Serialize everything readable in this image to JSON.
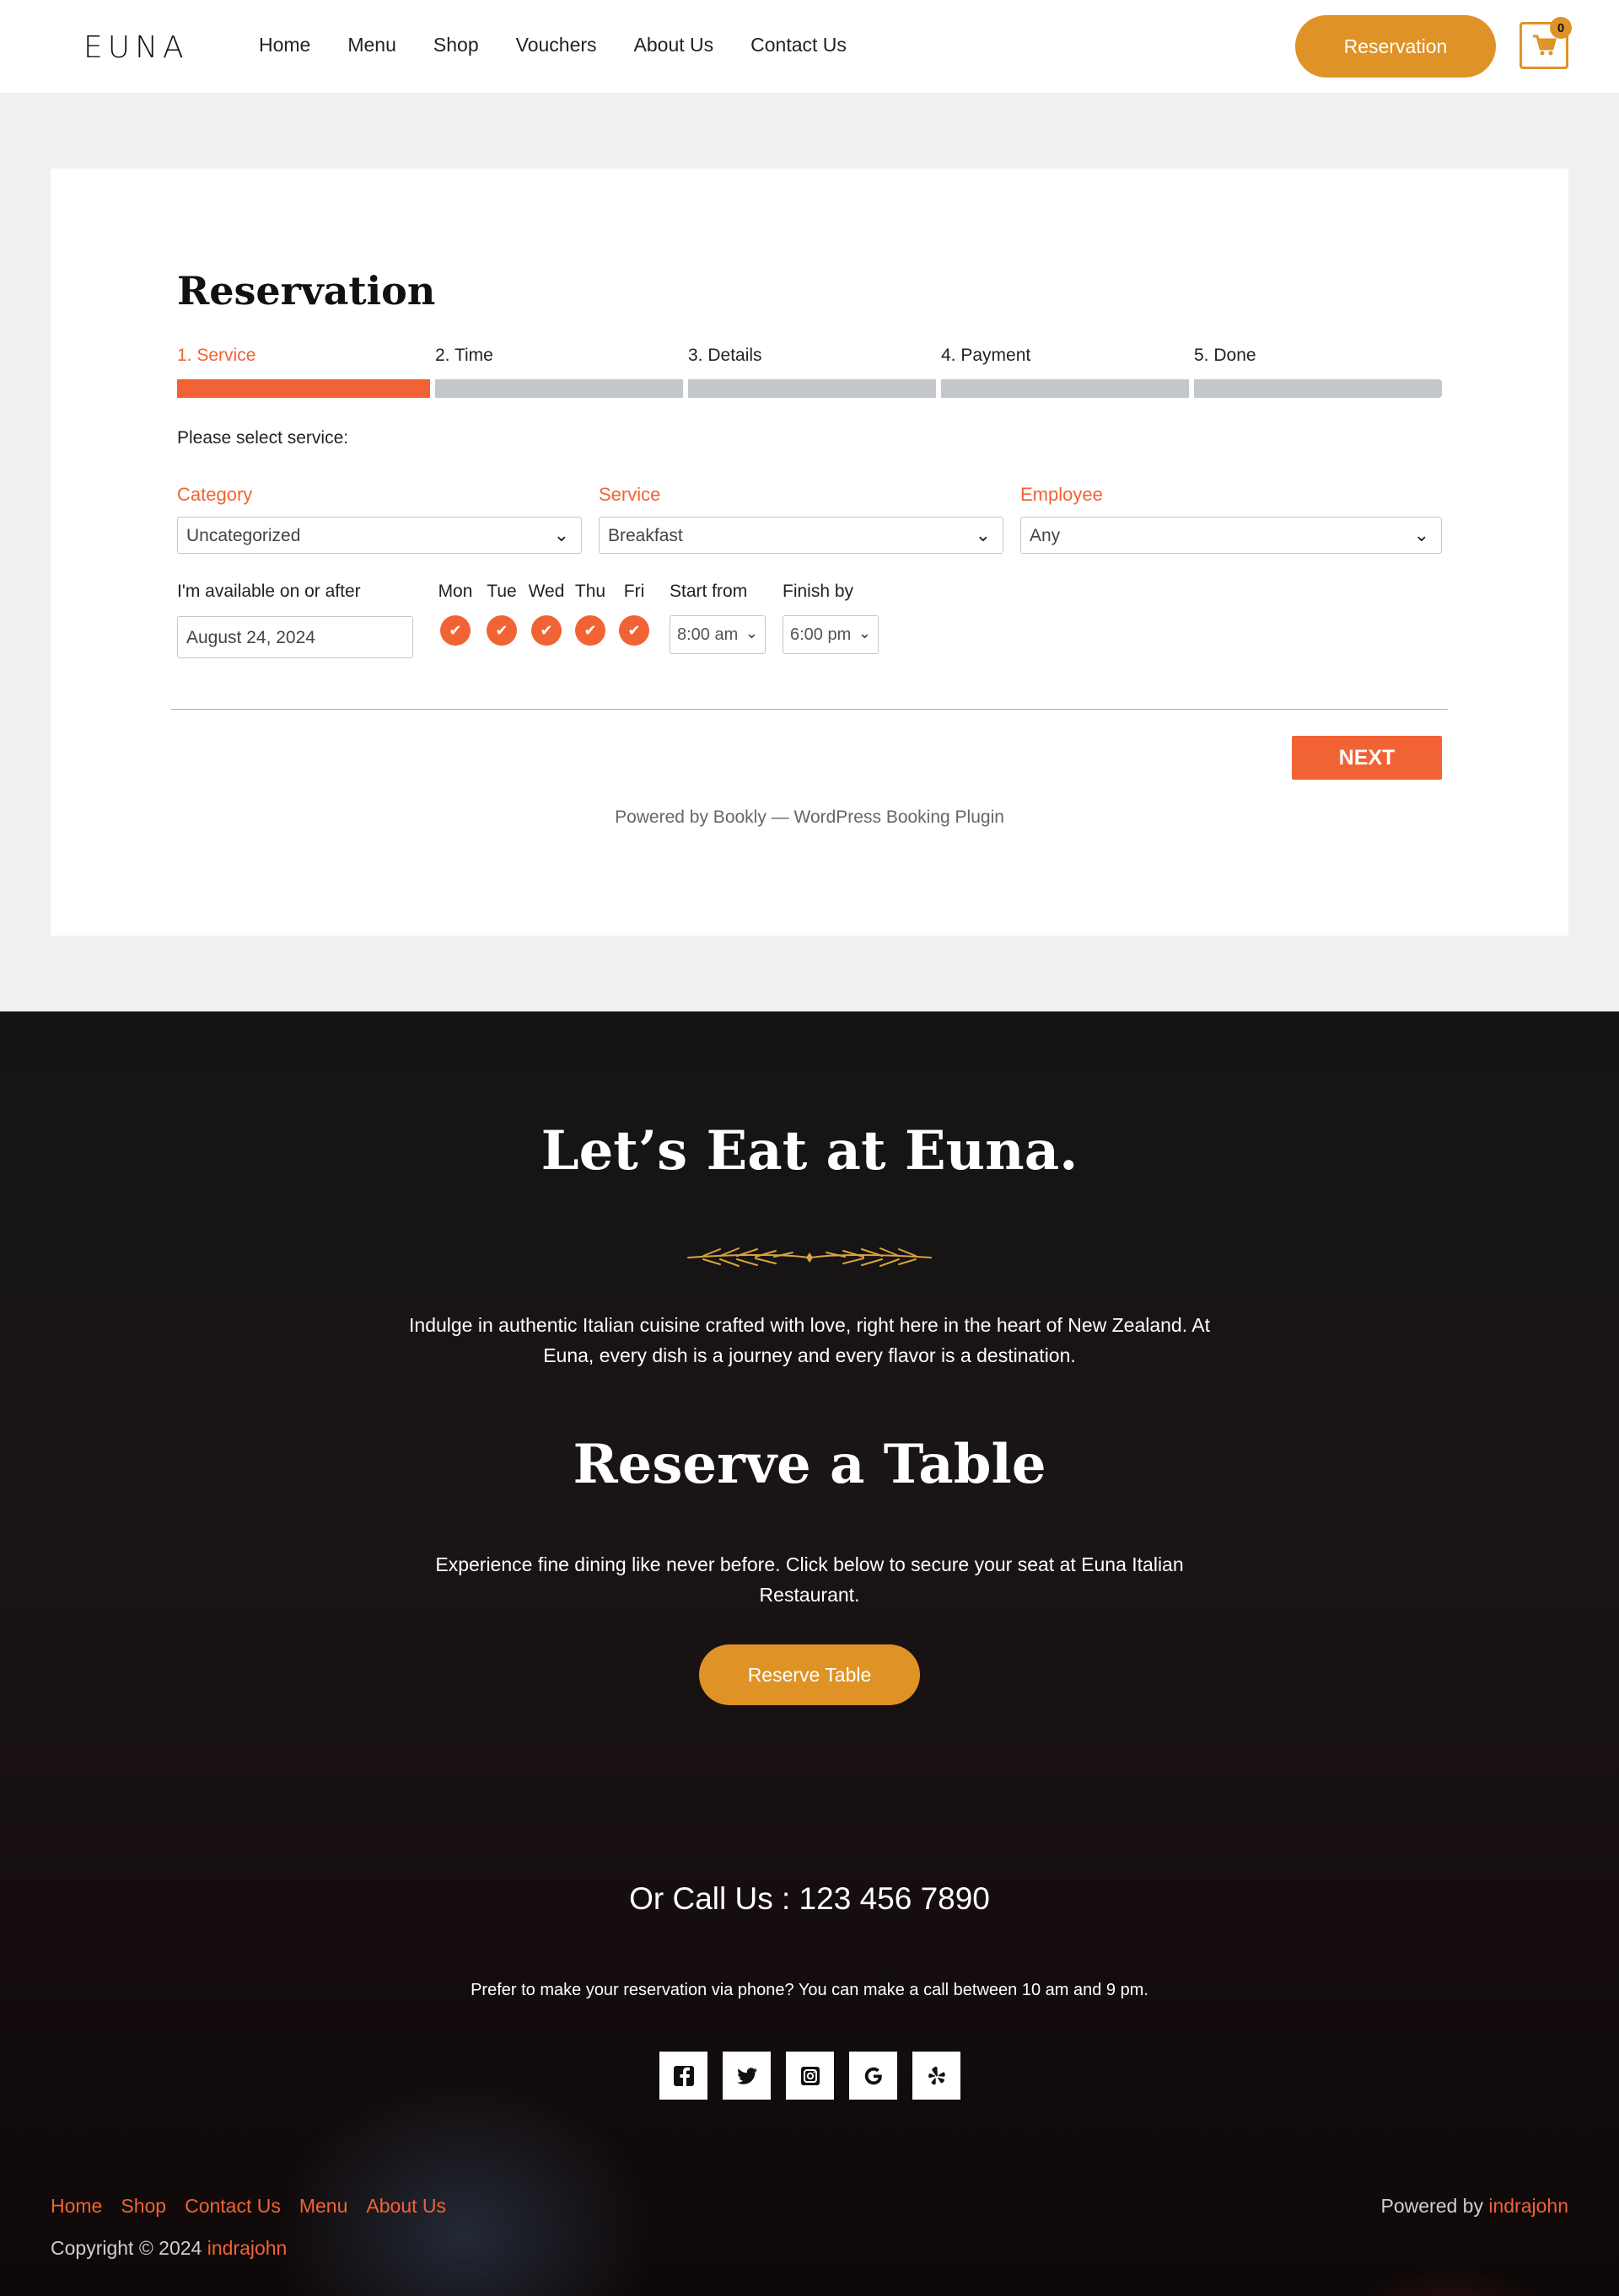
{
  "header": {
    "logo": "EUNA",
    "nav": [
      "Home",
      "Menu",
      "Shop",
      "Vouchers",
      "About Us",
      "Contact Us"
    ],
    "reservation_button": "Reservation",
    "cart_count": "0"
  },
  "booking": {
    "title": "Reservation",
    "steps": [
      {
        "label": "1. Service",
        "active": true
      },
      {
        "label": "2. Time",
        "active": false
      },
      {
        "label": "3. Details",
        "active": false
      },
      {
        "label": "4. Payment",
        "active": false
      },
      {
        "label": "5. Done",
        "active": false
      }
    ],
    "prompt": "Please select service:",
    "category_label": "Category",
    "category_value": "Uncategorized",
    "service_label": "Service",
    "service_value": "Breakfast",
    "employee_label": "Employee",
    "employee_value": "Any",
    "available_label": "I'm available on or after",
    "date_value": "August 24, 2024",
    "days": [
      "Mon",
      "Tue",
      "Wed",
      "Thu",
      "Fri"
    ],
    "start_label": "Start from",
    "start_value": "8:00 am",
    "finish_label": "Finish by",
    "finish_value": "6:00 pm",
    "next_button": "NEXT",
    "powered": "Powered by Bookly — WordPress Booking Plugin"
  },
  "footer": {
    "title": "Let’s Eat at Euna.",
    "intro": "Indulge in authentic Italian cuisine crafted with love, right here in the heart of New Zealand. At Euna, every dish is a journey and every flavor is a destination.",
    "reserve_title": "Reserve a Table",
    "experience": "Experience fine dining like never before. Click below to secure your seat at Euna Italian Restaurant.",
    "reserve_button": "Reserve Table",
    "call": "Or Call Us : 123 456 7890",
    "prefer": "Prefer to make your reservation via phone? You can make a call between 10 am and 9 pm.",
    "socials": [
      "facebook-icon",
      "twitter-icon",
      "instagram-icon",
      "google-icon",
      "yelp-icon"
    ],
    "links": [
      "Home",
      "Shop",
      "Contact Us",
      "Menu",
      "About Us"
    ],
    "copyright_prefix": "Copyright © 2024 ",
    "copyright_name": "indrajohn",
    "powered_prefix": "Powered by ",
    "powered_name": "indrajohn"
  },
  "colors": {
    "accent": "#df9326",
    "booking_accent": "#f16334",
    "step_inactive": "#c3c6ca"
  }
}
